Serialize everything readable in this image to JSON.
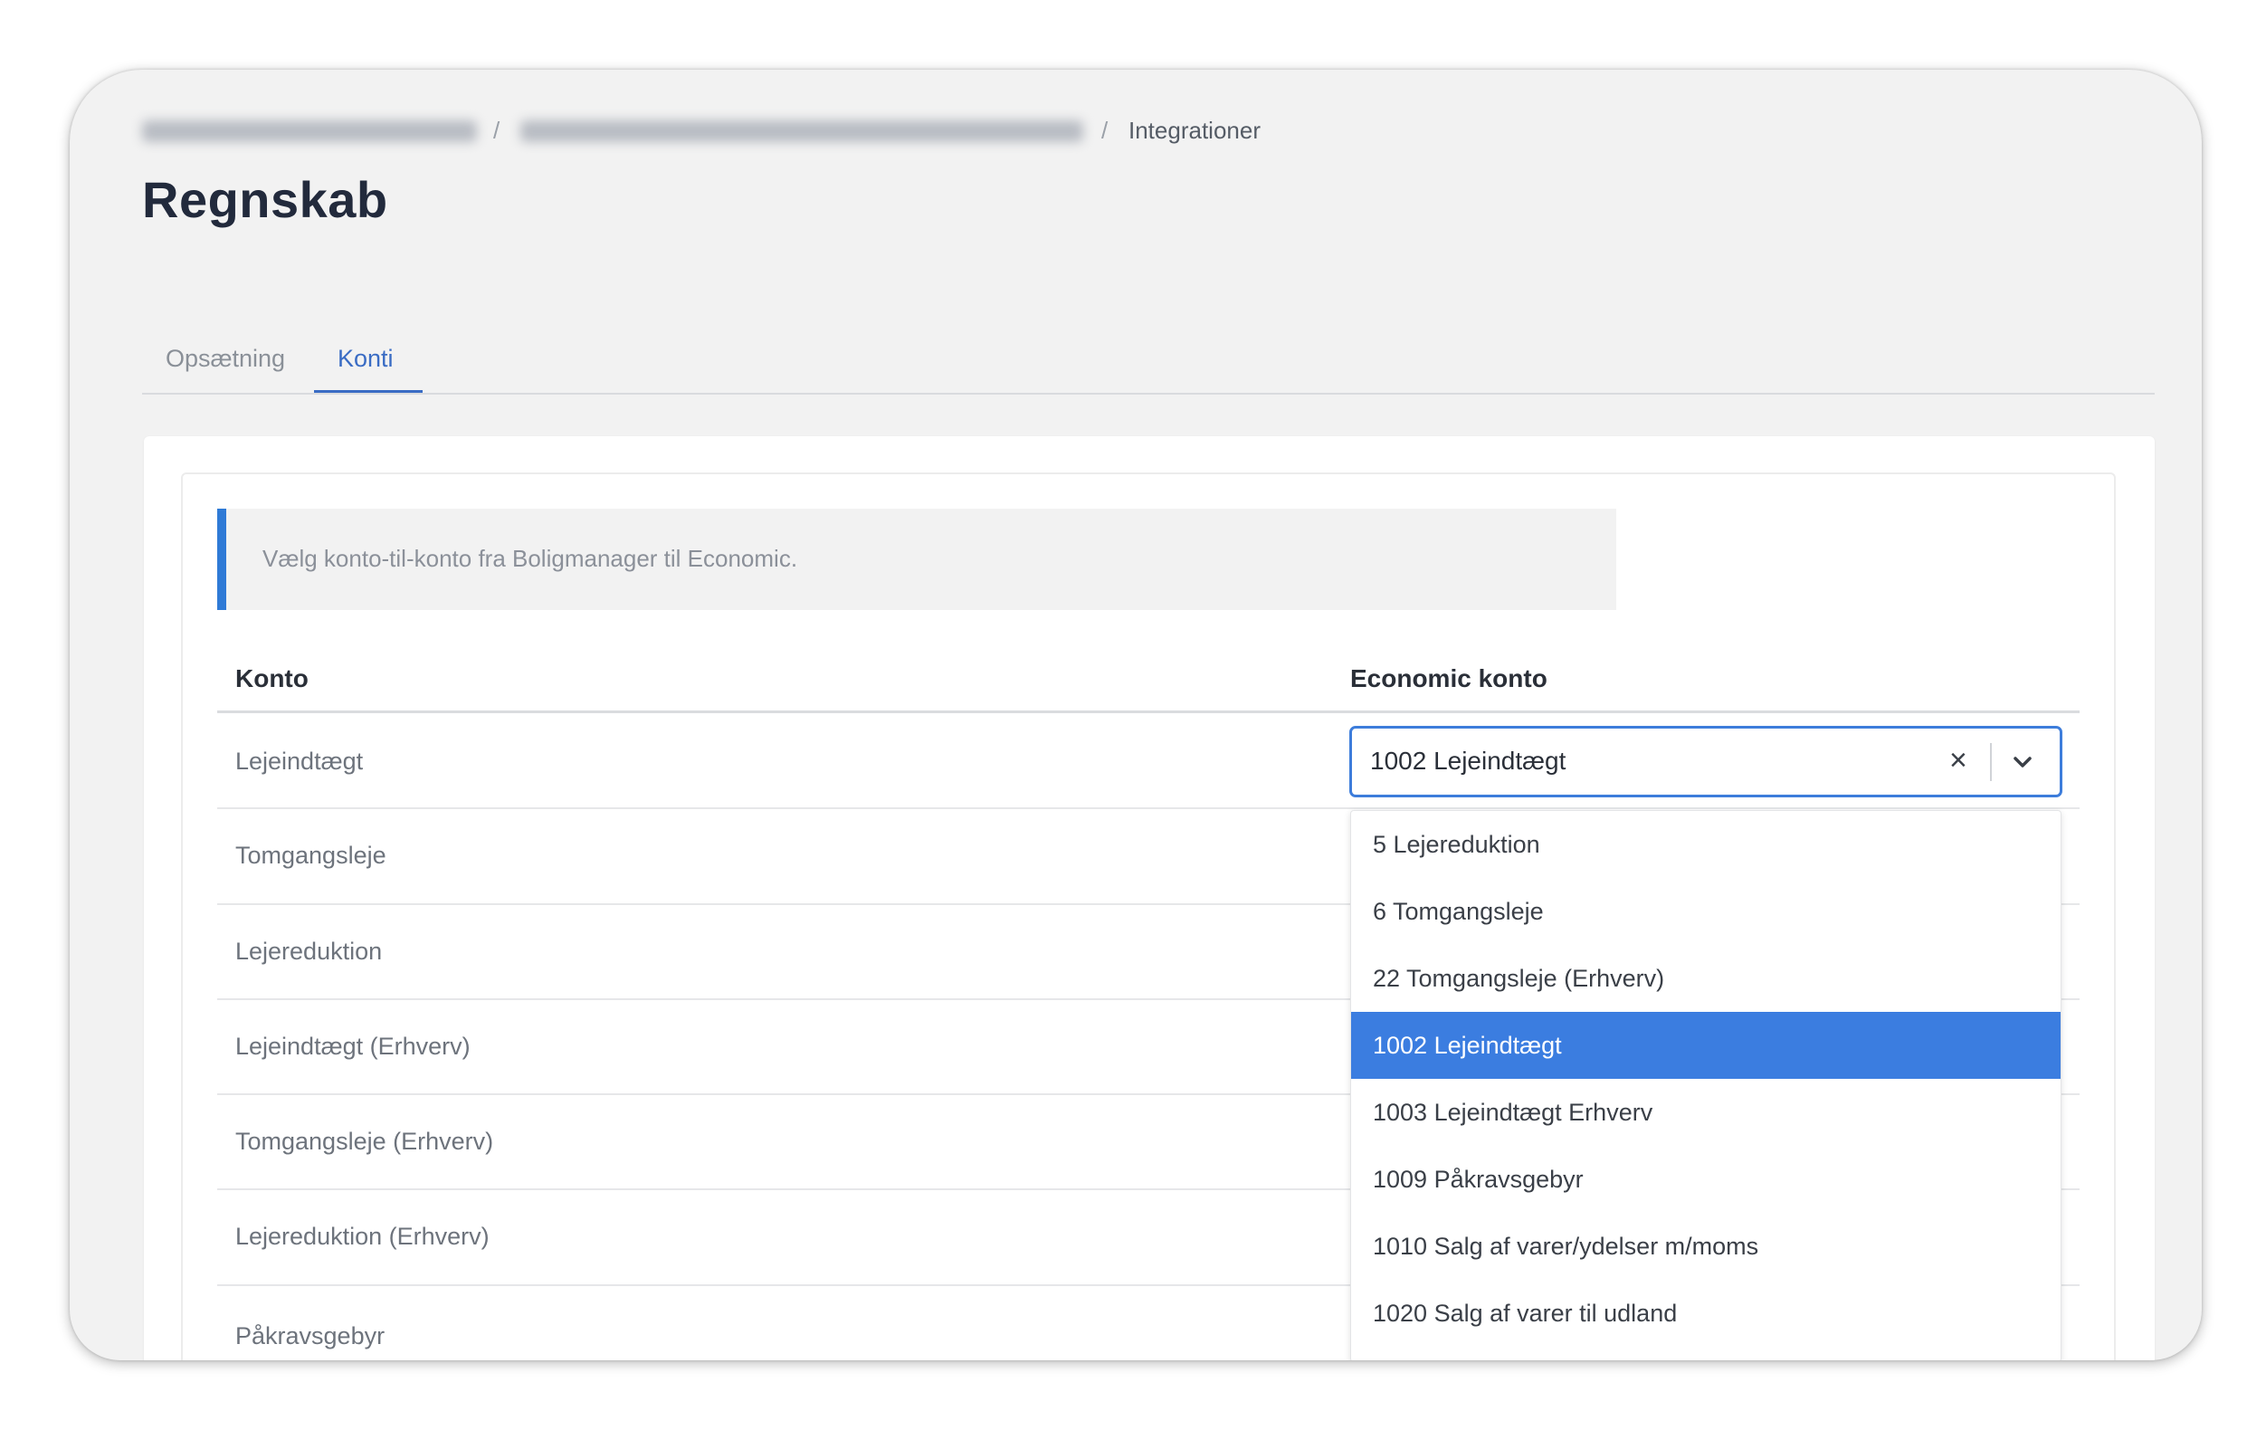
{
  "breadcrumb": {
    "current": "Integrationer",
    "separator": "/"
  },
  "page": {
    "title": "Regnskab"
  },
  "tabs": [
    {
      "label": "Opsætning",
      "active": false
    },
    {
      "label": "Konti",
      "active": true
    }
  ],
  "info": {
    "text": "Vælg konto-til-konto fra Boligmanager til Economic."
  },
  "table": {
    "headers": [
      "Konto",
      "Economic konto"
    ],
    "rows": [
      "Lejeindtægt",
      "Tomgangsleje",
      "Lejereduktion",
      "Lejeindtægt (Erhverv)",
      "Tomgangsleje (Erhverv)",
      "Lejereduktion (Erhverv)",
      "Påkravsgebyr"
    ]
  },
  "select": {
    "value": "1002 Lejeindtægt",
    "clear_icon": "×",
    "chevron_icon": "chevron-down-icon"
  },
  "dropdown": {
    "options": [
      "5 Lejereduktion",
      "6 Tomgangsleje",
      "22 Tomgangsleje (Erhverv)",
      "1002 Lejeindtægt",
      "1003 Lejeindtægt Erhverv",
      "1009 Påkravsgebyr",
      "1010 Salg af varer/ydelser m/moms",
      "1020 Salg af varer til udland"
    ],
    "selected_index": 3
  },
  "colors": {
    "accent": "#3a6cc4",
    "selected_option": "#3b7de0",
    "info_bar": "#2f7ad6",
    "frame_bg": "#f2f2f2"
  }
}
